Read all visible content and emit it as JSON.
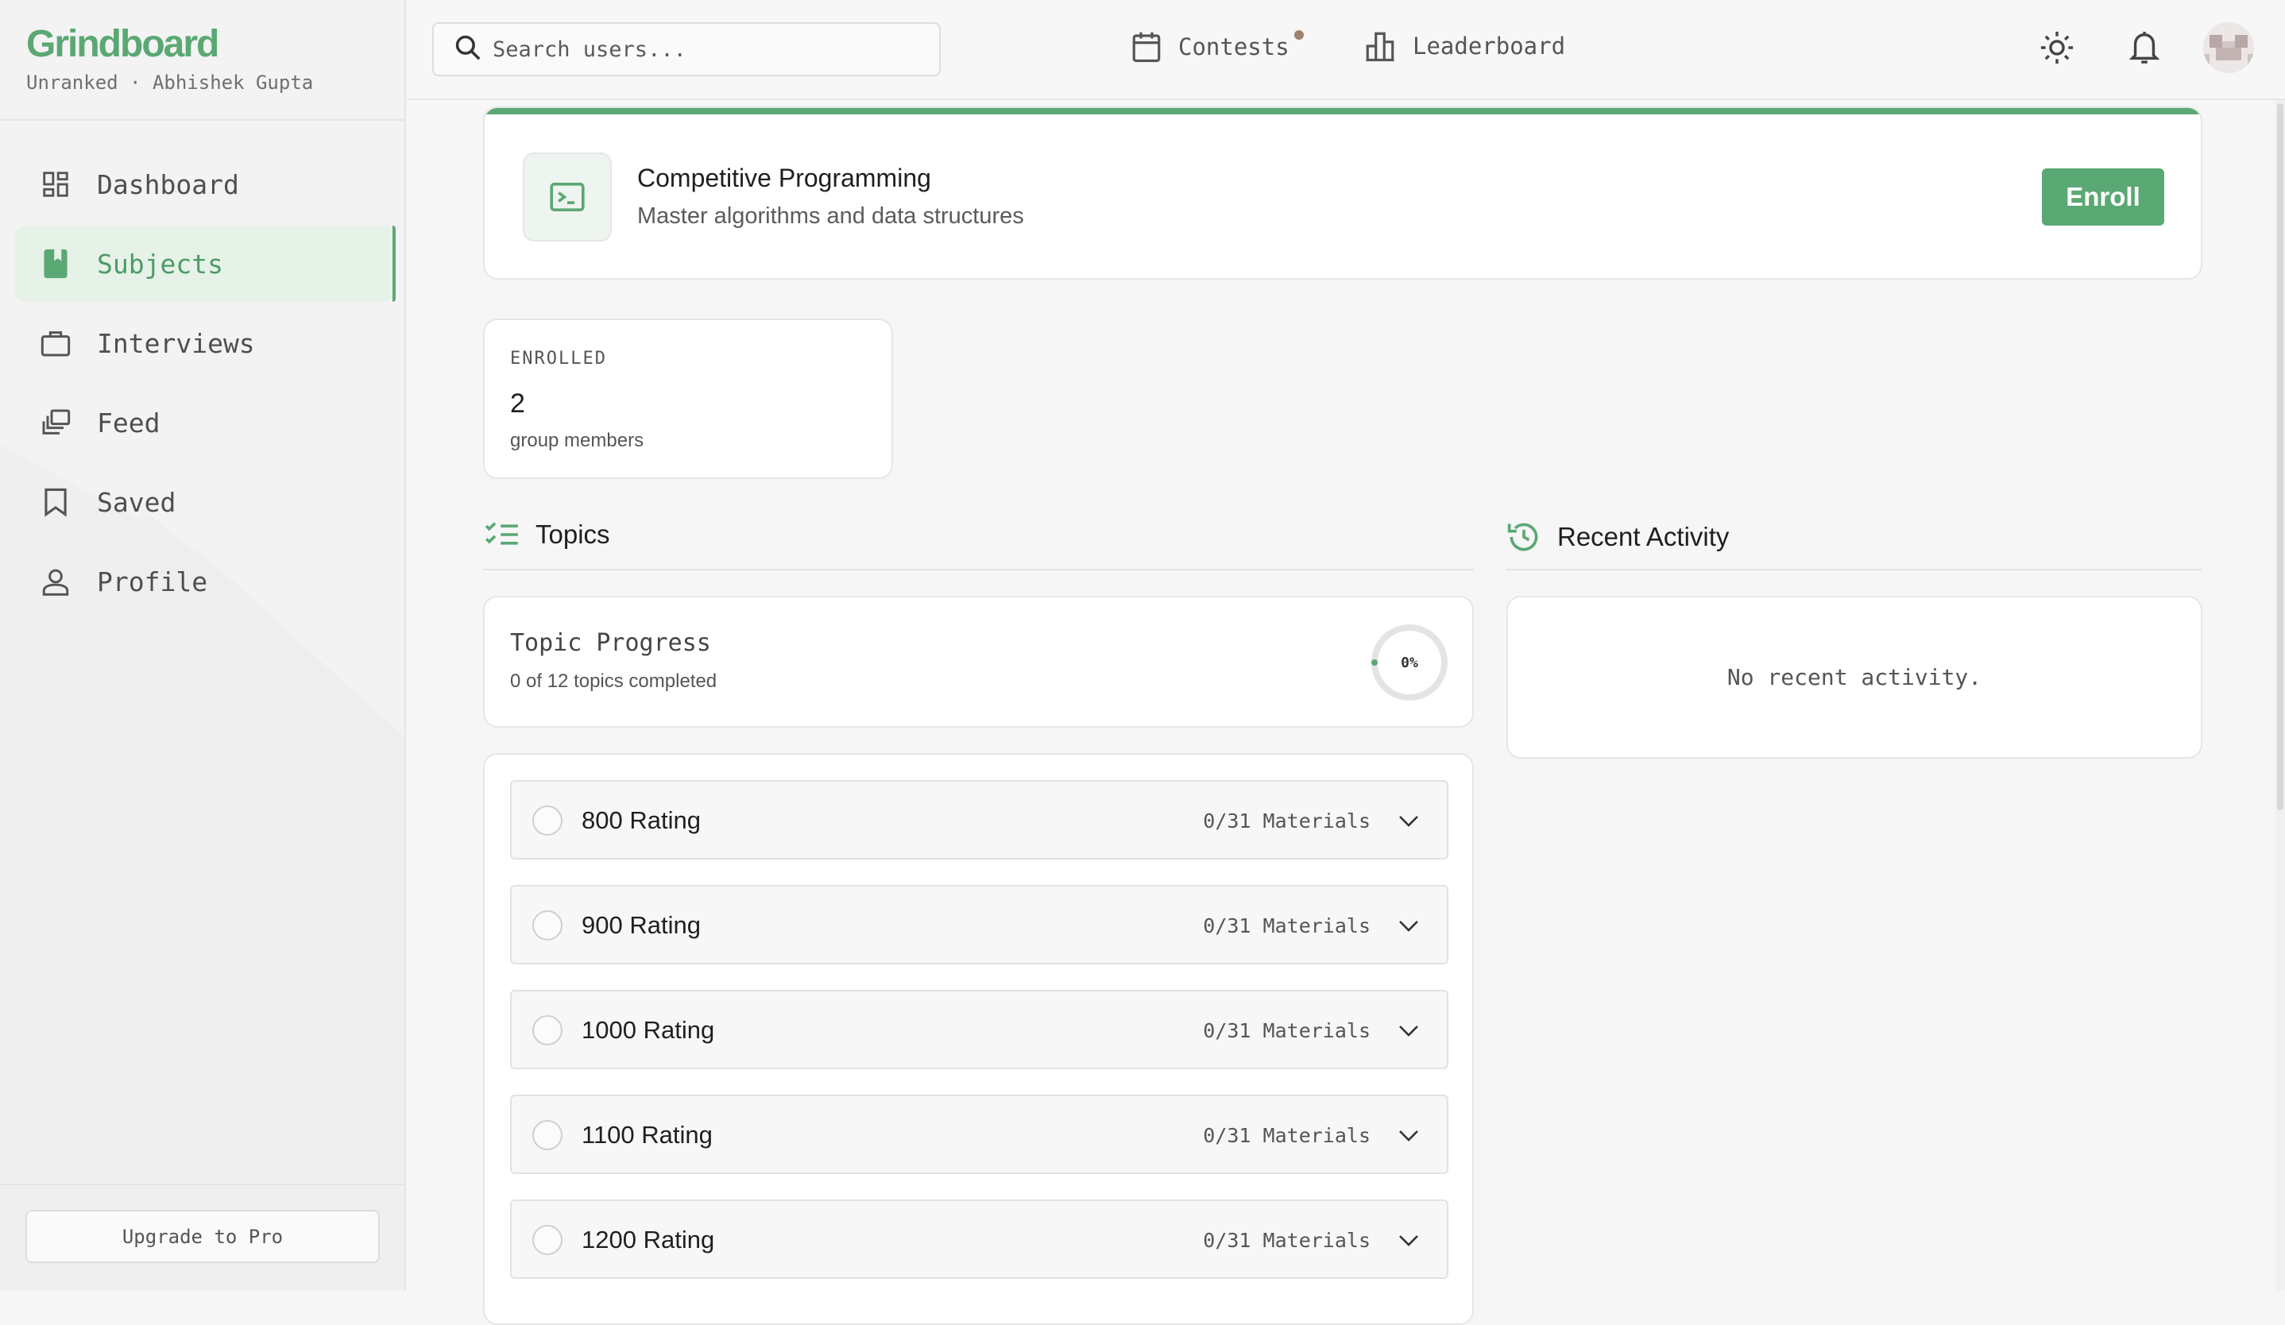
{
  "brand": {
    "name": "Grindboard",
    "subtitle": "Unranked · Abhishek Gupta",
    "accent": "#5aa873"
  },
  "sidebar": {
    "items": [
      {
        "label": "Dashboard",
        "icon": "dashboard-icon",
        "active": false
      },
      {
        "label": "Subjects",
        "icon": "book-icon",
        "active": true
      },
      {
        "label": "Interviews",
        "icon": "briefcase-icon",
        "active": false
      },
      {
        "label": "Feed",
        "icon": "feed-icon",
        "active": false
      },
      {
        "label": "Saved",
        "icon": "bookmark-icon",
        "active": false
      },
      {
        "label": "Profile",
        "icon": "user-icon",
        "active": false
      }
    ],
    "upgrade_label": "Upgrade to Pro"
  },
  "topbar": {
    "search_placeholder": "Search users...",
    "nav": [
      {
        "label": "Contests",
        "icon": "calendar-icon",
        "has_dot": true
      },
      {
        "label": "Leaderboard",
        "icon": "bar-chart-icon",
        "has_dot": false
      }
    ],
    "icons": [
      "sun-icon",
      "bell-icon",
      "avatar"
    ]
  },
  "subject": {
    "title": "Competitive Programming",
    "description": "Master algorithms and data structures",
    "icon": "terminal-icon",
    "enroll_label": "Enroll"
  },
  "enrolled": {
    "label": "ENROLLED",
    "value": "2",
    "sub": "group members"
  },
  "topics_section": {
    "heading": "Topics",
    "progress_title": "Topic Progress",
    "progress_sub": "0 of 12 topics completed",
    "progress_percent_label": "0%",
    "progress_fraction": 0
  },
  "activity_section": {
    "heading": "Recent Activity",
    "empty_text": "No recent activity."
  },
  "topics": [
    {
      "name": "800 Rating",
      "materials": "0/31 Materials"
    },
    {
      "name": "900 Rating",
      "materials": "0/31 Materials"
    },
    {
      "name": "1000 Rating",
      "materials": "0/31 Materials"
    },
    {
      "name": "1100 Rating",
      "materials": "0/31 Materials"
    },
    {
      "name": "1200 Rating",
      "materials": "0/31 Materials"
    }
  ]
}
